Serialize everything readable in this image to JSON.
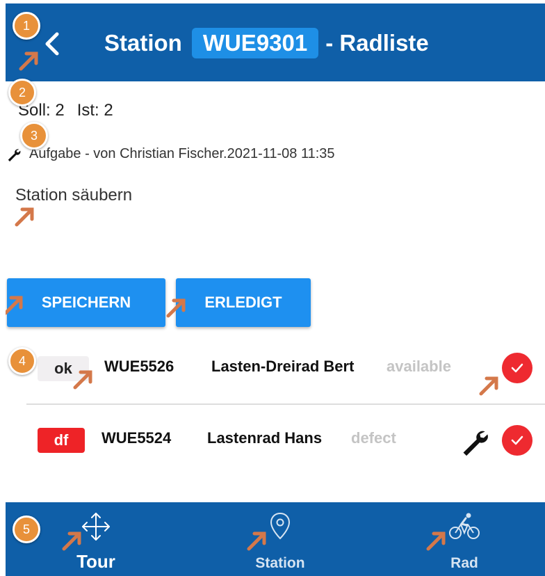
{
  "header": {
    "title_prefix": "Station",
    "station_id": "WUE9301",
    "title_suffix": "- Radliste"
  },
  "counts": {
    "soll": "Soll: 2",
    "ist": "Ist: 2"
  },
  "task": {
    "line": "Aufgabe - von Christian Fischer.2021-11-08 11:35",
    "note": "Station säubern"
  },
  "buttons": {
    "save": "SPEICHERN",
    "done": "ERLEDIGT"
  },
  "bikes": [
    {
      "badge": "ok",
      "id": "WUE5526",
      "name": "Lasten-Dreirad Bert",
      "state": "available"
    },
    {
      "badge": "df",
      "id": "WUE5524",
      "name": "Lastenrad Hans",
      "state": "defect"
    }
  ],
  "nav": {
    "tour": "Tour",
    "station": "Station",
    "rad": "Rad"
  },
  "annotations": [
    "1",
    "2",
    "3",
    "4",
    "5"
  ],
  "colors": {
    "header": "#0f5fa8",
    "accent": "#1e90f0",
    "danger": "#ee2a30",
    "annotation": "#e8913a"
  }
}
